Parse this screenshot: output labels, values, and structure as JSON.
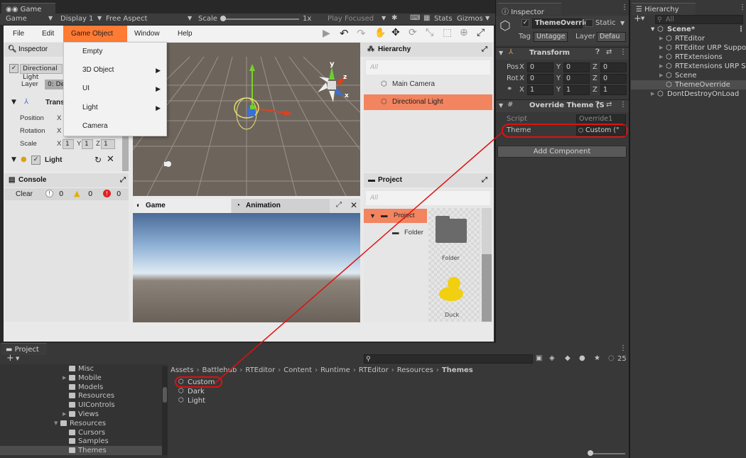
{
  "game_window": {
    "tab_title": "Game",
    "toolbar": {
      "mode": "Game",
      "display": "Display 1",
      "aspect": "Free Aspect",
      "scale_label": "Scale",
      "scale_value": "1x",
      "play_focused": "Play Focused",
      "stats": "Stats",
      "gizmos": "Gizmos"
    }
  },
  "runtime_editor": {
    "menu": [
      "File",
      "Edit",
      "Game Object",
      "Window",
      "Help"
    ],
    "active_menu": "Game Object",
    "dropdown": [
      {
        "label": "Empty",
        "submenu": false
      },
      {
        "label": "3D Object",
        "submenu": true
      },
      {
        "label": "UI",
        "submenu": true
      },
      {
        "label": "Light",
        "submenu": true
      },
      {
        "label": "Camera",
        "submenu": false
      }
    ],
    "inspector": {
      "title": "Inspector",
      "object_name": "Directional Light",
      "layer_label": "Layer",
      "layer_value": "0: De",
      "transform_title": "Trans",
      "rows": [
        {
          "label": "Position",
          "x": ""
        },
        {
          "label": "Rotation",
          "x": ""
        },
        {
          "label": "Scale",
          "x": "1",
          "y": "1",
          "z": "1"
        }
      ],
      "axis_x": "X",
      "axis_y": "Y",
      "axis_z": "Z",
      "light_label": "Light"
    },
    "console": {
      "title": "Console",
      "clear": "Clear",
      "info_count": "0",
      "warn_count": "0",
      "error_count": "0"
    },
    "scene_axes": {
      "y": "y",
      "x": "x",
      "z": "z"
    },
    "game_tab": "Game",
    "animation_tab": "Animation",
    "hierarchy": {
      "title": "Hierarchy",
      "filter": "All",
      "items": [
        "Main Camera",
        "Directional Light"
      ],
      "selected": "Directional Light"
    },
    "project": {
      "title": "Project",
      "filter": "All",
      "tree": [
        "Project",
        "Folder"
      ],
      "assets": [
        "Folder",
        "Duck"
      ]
    }
  },
  "inspector": {
    "tab_title": "Inspector",
    "object_name": "ThemeOverrid",
    "static_label": "Static",
    "tag_label": "Tag",
    "tag_value": "Untagge",
    "layer_label": "Layer",
    "layer_value": "Defau",
    "transform": {
      "title": "Transform",
      "pos_label": "Pos",
      "rot_label": "Rot",
      "pos": [
        "0",
        "0",
        "0"
      ],
      "rot": [
        "0",
        "0",
        "0"
      ],
      "scale": [
        "1",
        "1",
        "1"
      ],
      "axes": [
        "X",
        "Y",
        "Z"
      ]
    },
    "component": {
      "title": "Override Theme (S",
      "script_label": "Script",
      "script_value": "Override1",
      "theme_label": "Theme",
      "theme_value": "Custom (\""
    },
    "add_component": "Add Component"
  },
  "hierarchy": {
    "tab_title": "Hierarchy",
    "search_placeholder": "All",
    "scene": "Scene*",
    "items": [
      "RTEditor",
      "RTEditor URP Support",
      "RTExtensions",
      "RTExtensions URP Sup",
      "Scene",
      "ThemeOverride"
    ],
    "dont_destroy": "DontDestroyOnLoad"
  },
  "project": {
    "tab_title": "Project",
    "tree": [
      {
        "label": "Misc",
        "indent": 3,
        "arrow": false
      },
      {
        "label": "Mobile",
        "indent": 3,
        "arrow": true
      },
      {
        "label": "Models",
        "indent": 3,
        "arrow": false
      },
      {
        "label": "Resources",
        "indent": 3,
        "arrow": false
      },
      {
        "label": "UIControls",
        "indent": 3,
        "arrow": false
      },
      {
        "label": "Views",
        "indent": 3,
        "arrow": true
      },
      {
        "label": "Resources",
        "indent": 2,
        "arrow": true
      },
      {
        "label": "Cursors",
        "indent": 3,
        "arrow": false
      },
      {
        "label": "Samples",
        "indent": 3,
        "arrow": false
      },
      {
        "label": "Themes",
        "indent": 3,
        "arrow": false
      }
    ],
    "breadcrumb": [
      "Assets",
      "Battlehub",
      "RTEditor",
      "Content",
      "Runtime",
      "RTEditor",
      "Resources",
      "Themes"
    ],
    "assets": [
      "Custom",
      "Dark",
      "Light"
    ],
    "hidden_count": "25"
  },
  "colors": {
    "accent": "#ff7a33",
    "selection": "#f28460",
    "annotation": "#e01010"
  }
}
